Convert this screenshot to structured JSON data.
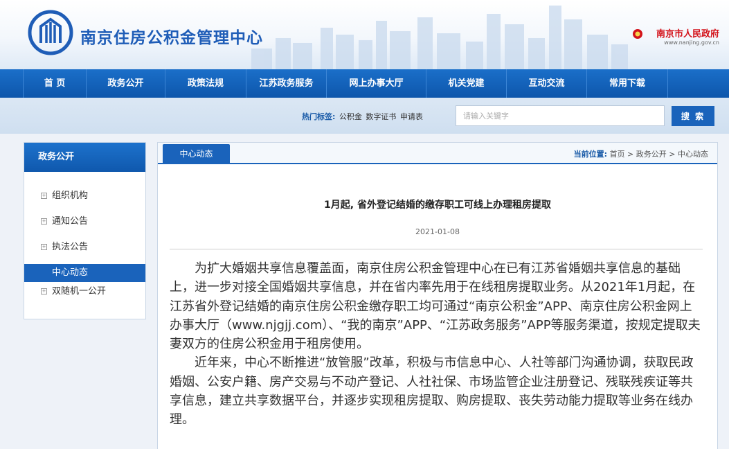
{
  "header": {
    "site_title": "南京住房公积金管理中心",
    "gov_name": "南京市人民政府",
    "gov_url": "www.nanjing.gov.cn"
  },
  "nav": {
    "items": [
      {
        "label": "首  页"
      },
      {
        "label": "政务公开"
      },
      {
        "label": "政策法规"
      },
      {
        "label": "江苏政务服务"
      },
      {
        "label": "网上办事大厅"
      },
      {
        "label": "机关党建"
      },
      {
        "label": "互动交流"
      },
      {
        "label": "常用下载"
      }
    ]
  },
  "search": {
    "hot_label": "热门标签:",
    "tags": [
      "公积金",
      "数字证书",
      "申请表"
    ],
    "placeholder": "请输入关键字",
    "button_label": "搜 索"
  },
  "sidebar": {
    "title": "政务公开",
    "items": [
      {
        "label": "组织机构"
      },
      {
        "label": "通知公告"
      },
      {
        "label": "执法公告"
      },
      {
        "label": "中心动态"
      },
      {
        "label": "双随机一公开"
      }
    ]
  },
  "main": {
    "tab_label": "中心动态",
    "breadcrumb_label": "当前位置:",
    "breadcrumb": [
      "首页",
      "政务公开",
      "中心动态"
    ],
    "breadcrumb_sep": " > ",
    "title": "1月起, 省外登记结婚的缴存职工可线上办理租房提取",
    "date": "2021-01-08",
    "paragraphs": [
      "为扩大婚姻共享信息覆盖面，南京住房公积金管理中心在已有江苏省婚姻共享信息的基础上，进一步对接全国婚姻共享信息，并在省内率先用于在线租房提取业务。从2021年1月起，在江苏省外登记结婚的南京住房公积金缴存职工均可通过“南京公积金”APP、南京住房公积金网上办事大厅（www.njgjj.com）、“我的南京”APP、“江苏政务服务”APP等服务渠道，按规定提取夫妻双方的住房公积金用于租房使用。",
      "近年来，中心不断推进“放管服”改革，积极与市信息中心、人社等部门沟通协调，获取民政婚姻、公安户籍、房产交易与不动产登记、人社社保、市场监管企业注册登记、残联残疾证等共享信息，建立共享数据平台，并逐步实现租房提取、购房提取、丧失劳动能力提取等业务在线办理。"
    ]
  },
  "colors": {
    "nav_blue": "#1a63bb",
    "title_blue": "#1f5db7",
    "gov_red": "#d3121a"
  },
  "icons": {
    "logo": "njgjj-logo-icon",
    "emblem": "gov-emblem-icon",
    "bullet": "plus-square-icon"
  }
}
